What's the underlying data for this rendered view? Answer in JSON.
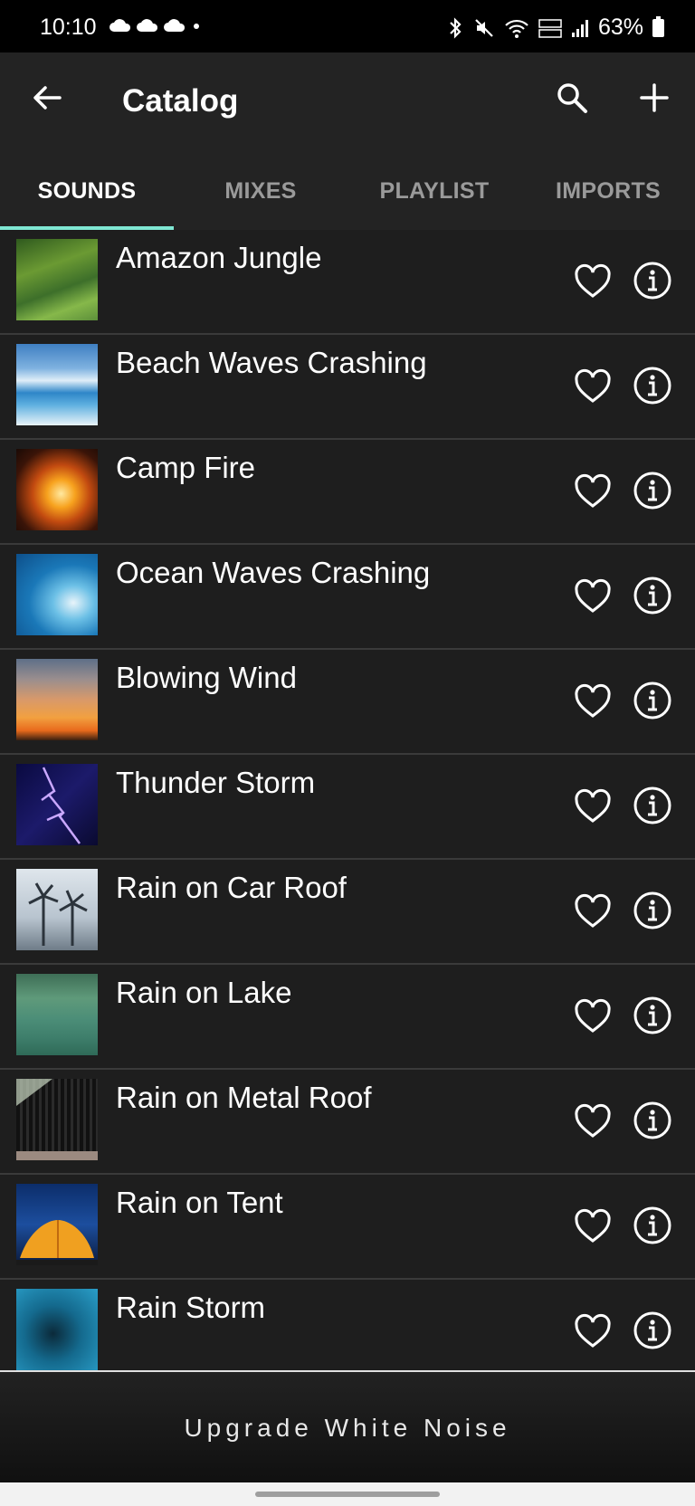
{
  "status_bar": {
    "time": "10:10",
    "battery": "63%",
    "icons": [
      "cloud-sync-icon",
      "cloud-sync-icon",
      "cloud-sync-icon",
      "notification-dot-icon",
      "bluetooth-icon",
      "mute-icon",
      "wifi-icon",
      "volte-icon",
      "signal-icon",
      "battery-icon"
    ]
  },
  "app_bar": {
    "title": "Catalog",
    "icons": [
      "back-arrow-icon",
      "search-icon",
      "add-icon"
    ]
  },
  "tabs": [
    {
      "label": "SOUNDS",
      "active": true
    },
    {
      "label": "MIXES",
      "active": false
    },
    {
      "label": "PLAYLIST",
      "active": false
    },
    {
      "label": "IMPORTS",
      "active": false
    }
  ],
  "accent_color": "#7fe7d3",
  "sounds": [
    {
      "label": "Amazon Jungle"
    },
    {
      "label": "Beach Waves Crashing"
    },
    {
      "label": "Camp Fire"
    },
    {
      "label": "Ocean Waves Crashing"
    },
    {
      "label": "Blowing Wind"
    },
    {
      "label": "Thunder Storm"
    },
    {
      "label": "Rain on Car Roof"
    },
    {
      "label": "Rain on Lake"
    },
    {
      "label": "Rain on Metal Roof"
    },
    {
      "label": "Rain on Tent"
    },
    {
      "label": "Rain Storm"
    }
  ],
  "footer": {
    "upgrade_label": "Upgrade White Noise"
  }
}
